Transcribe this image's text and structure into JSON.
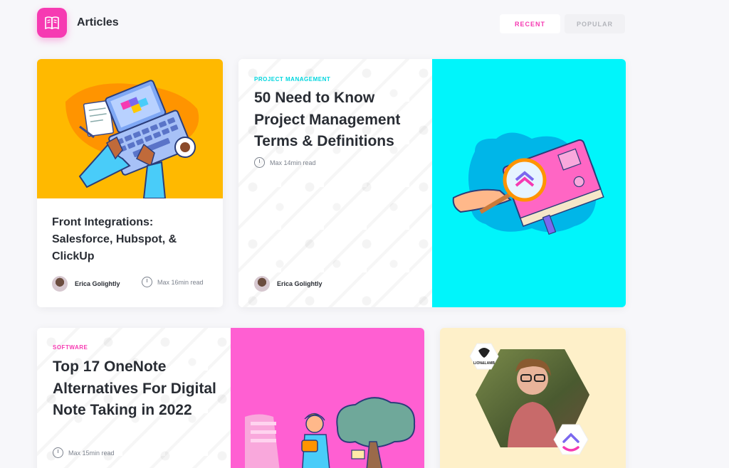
{
  "header": {
    "title": "Articles",
    "logo_icon": "book-icon"
  },
  "tabs": {
    "recent": "RECENT",
    "popular": "POPULAR"
  },
  "colors": {
    "accent": "#f63ab2",
    "card1_bg": "#ffb900",
    "card2_bg": "#00f5fb",
    "card3_bg": "#ff5fd2",
    "card4_bg": "#fef0c9",
    "pm_category": "#00d6de"
  },
  "cards": [
    {
      "title": "Front Integrations: Salesforce, Hubspot, & ClickUp",
      "author": "Erica Golightly",
      "read_time": "Max 16min read",
      "image": "laptop-puzzle-illustration"
    },
    {
      "category": "PROJECT MANAGEMENT",
      "title": "50 Need to Know Project Management Terms & Definitions",
      "author": "Erica Golightly",
      "read_time": "Max 14min read",
      "image": "magnifier-book-illustration"
    },
    {
      "category": "SOFTWARE",
      "title": "Top 17 OneNote Alternatives For Digital Note Taking in 2022",
      "read_time": "Max 15min read",
      "image": "woman-tree-illustration"
    },
    {
      "image": "person-hexagon-photo",
      "badge_left": "LION&LAMB",
      "badge_right": "clickup-logo"
    }
  ]
}
